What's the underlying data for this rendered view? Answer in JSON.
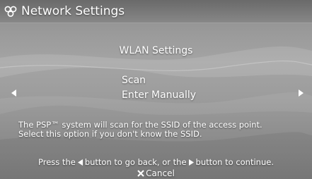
{
  "header": {
    "title": "Network Settings",
    "icon": "network-settings-icon"
  },
  "menu": {
    "heading": "WLAN Settings",
    "options": [
      {
        "label": "Scan",
        "selected": true
      },
      {
        "label": "Enter Manually",
        "selected": false
      }
    ]
  },
  "description": {
    "line1": "The PSP™ system will scan for the SSID of the access point.",
    "line2": "Select this option if you don't know the SSID."
  },
  "footer": {
    "hint_part1": "Press the",
    "hint_part2": "button to go back, or the",
    "hint_part3": "button to continue.",
    "cancel_label": "Cancel"
  },
  "colors": {
    "text": "#ffffff",
    "background": "#9a9a9a"
  }
}
